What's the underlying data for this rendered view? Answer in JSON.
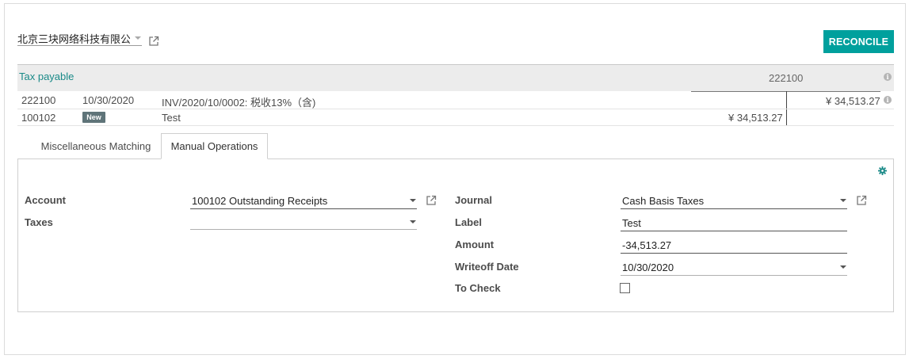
{
  "partner": {
    "name": "北京三块网络科技有限公司"
  },
  "toolbar": {
    "reconcile_label": "RECONCILE"
  },
  "header": {
    "account_label": "Tax payable",
    "account_code": "222100"
  },
  "lines": [
    {
      "account": "222100",
      "date": "10/30/2020",
      "label": "INV/2020/10/0002: 税收13%（含)",
      "debit": "",
      "credit": "¥ 34,513.27"
    },
    {
      "account": "100102",
      "badge": "New",
      "label": "Test",
      "debit": "¥ 34,513.27",
      "credit": ""
    }
  ],
  "tabs": [
    {
      "label": "Miscellaneous Matching",
      "active": false
    },
    {
      "label": "Manual Operations",
      "active": true
    }
  ],
  "form": {
    "account_label": "Account",
    "account_value": "100102 Outstanding Receipts",
    "taxes_label": "Taxes",
    "taxes_value": "",
    "journal_label": "Journal",
    "journal_value": "Cash Basis Taxes",
    "label_label": "Label",
    "label_value": "Test",
    "amount_label": "Amount",
    "amount_value": "-34,513.27",
    "writeoff_date_label": "Writeoff Date",
    "writeoff_date_value": "10/30/2020",
    "to_check_label": "To Check",
    "to_check_value": false
  },
  "colors": {
    "accent": "#00a09d",
    "link": "#1a8a88",
    "badge": "#5f7479"
  }
}
